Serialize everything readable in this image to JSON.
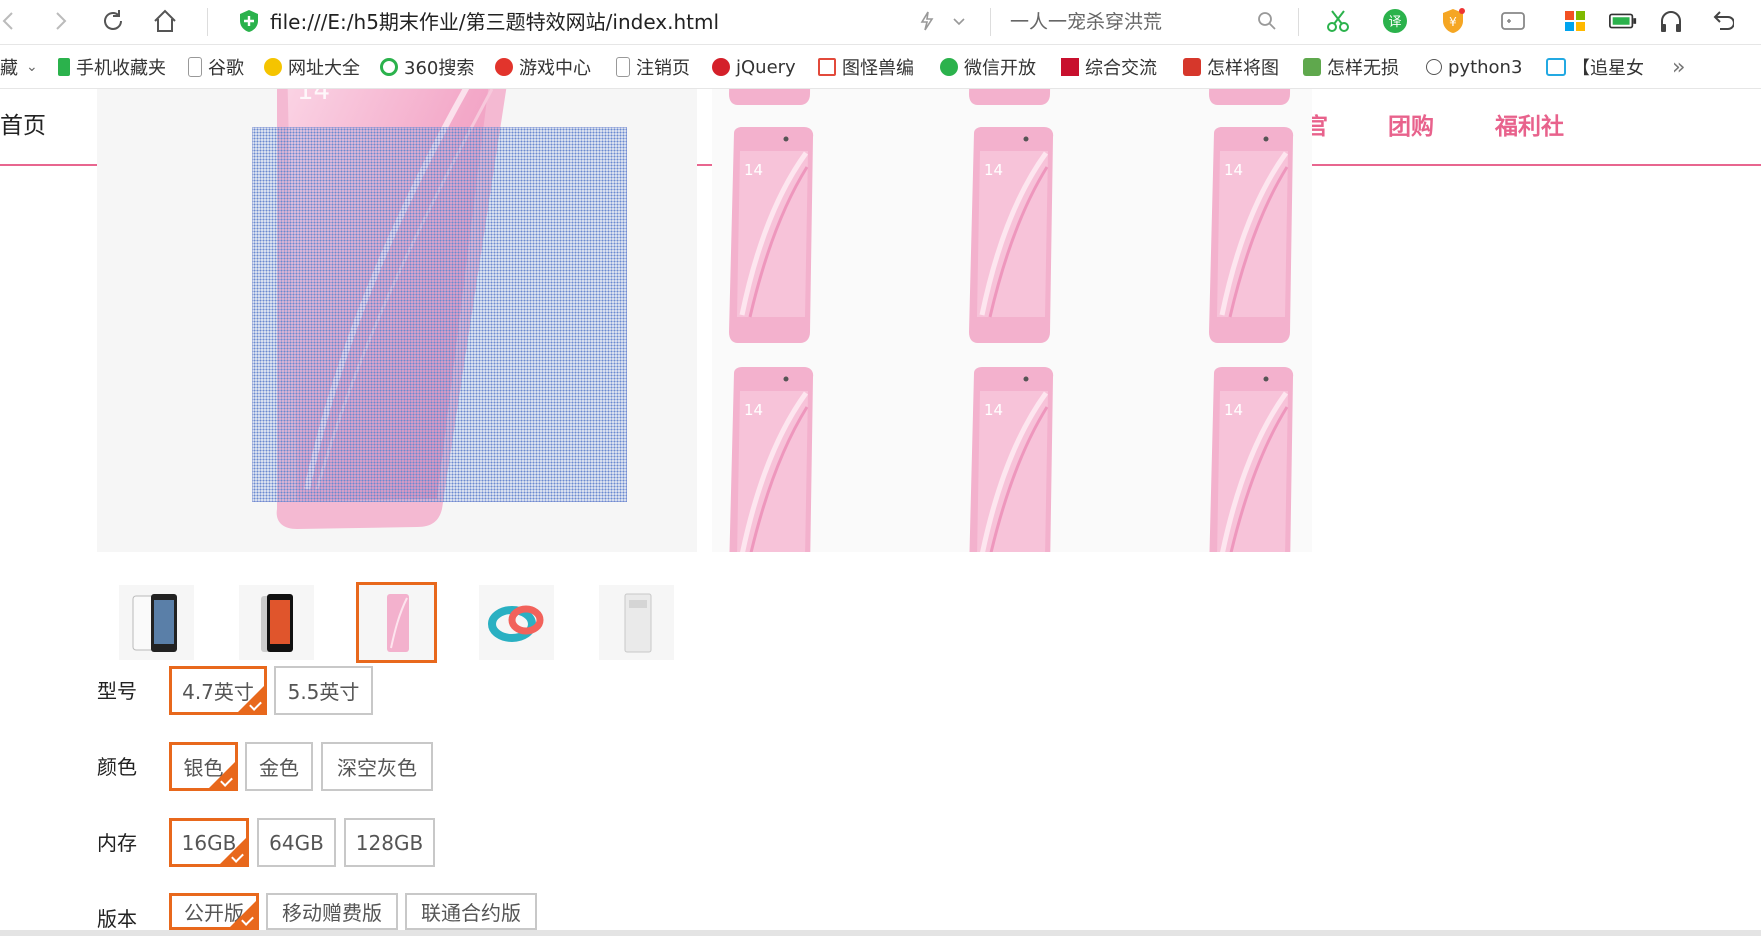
{
  "browser": {
    "url": "file:///E:/h5期末作业/第三题特效网站/index.html",
    "search_text": "一人一宠杀穿洪荒",
    "bookmarks": [
      {
        "label": "藏",
        "icon": "chevron-down-icon"
      },
      {
        "label": "手机收藏夹",
        "icon": "phone-icon"
      },
      {
        "label": "谷歌",
        "icon": "page-icon"
      },
      {
        "label": "网址大全",
        "icon": "plus-circle-icon"
      },
      {
        "label": "360搜索",
        "icon": "360-icon"
      },
      {
        "label": "游戏中心",
        "icon": "game-icon"
      },
      {
        "label": "注销页",
        "icon": "page-icon"
      },
      {
        "label": "jQuery",
        "icon": "q-icon"
      },
      {
        "label": "图怪兽编",
        "icon": "tu-icon"
      },
      {
        "label": "微信开放",
        "icon": "wechat-icon"
      },
      {
        "label": "综合交流",
        "icon": "fc-icon"
      },
      {
        "label": "怎样将图",
        "icon": "kuai-icon"
      },
      {
        "label": "怎样无损",
        "icon": "image-icon"
      },
      {
        "label": "python3",
        "icon": "python-icon"
      },
      {
        "label": "【追星女",
        "icon": "bilibili-icon"
      },
      {
        "label": "»",
        "icon": "more-icon"
      }
    ]
  },
  "nav": {
    "home": "首页",
    "items": [
      "官",
      "团购",
      "福利社"
    ]
  },
  "product": {
    "thumbnails": [
      "white-phone",
      "black-phone",
      "pink-phone",
      "band",
      "purifier"
    ],
    "selected_thumbnail": 2,
    "options": [
      {
        "label": "型号",
        "values": [
          "4.7英寸",
          "5.5英寸"
        ],
        "selected": 0
      },
      {
        "label": "颜色",
        "values": [
          "银色",
          "金色",
          "深空灰色"
        ],
        "selected": 0
      },
      {
        "label": "内存",
        "values": [
          "16GB",
          "64GB",
          "128GB"
        ],
        "selected": 0
      },
      {
        "label": "版本",
        "values": [
          "公开版",
          "移动赠费版",
          "联通合约版"
        ],
        "selected": 0
      }
    ]
  },
  "colors": {
    "accent": "#e8681c",
    "nav_pink": "#e8628c",
    "phone_pink": "#f3b1cd"
  }
}
